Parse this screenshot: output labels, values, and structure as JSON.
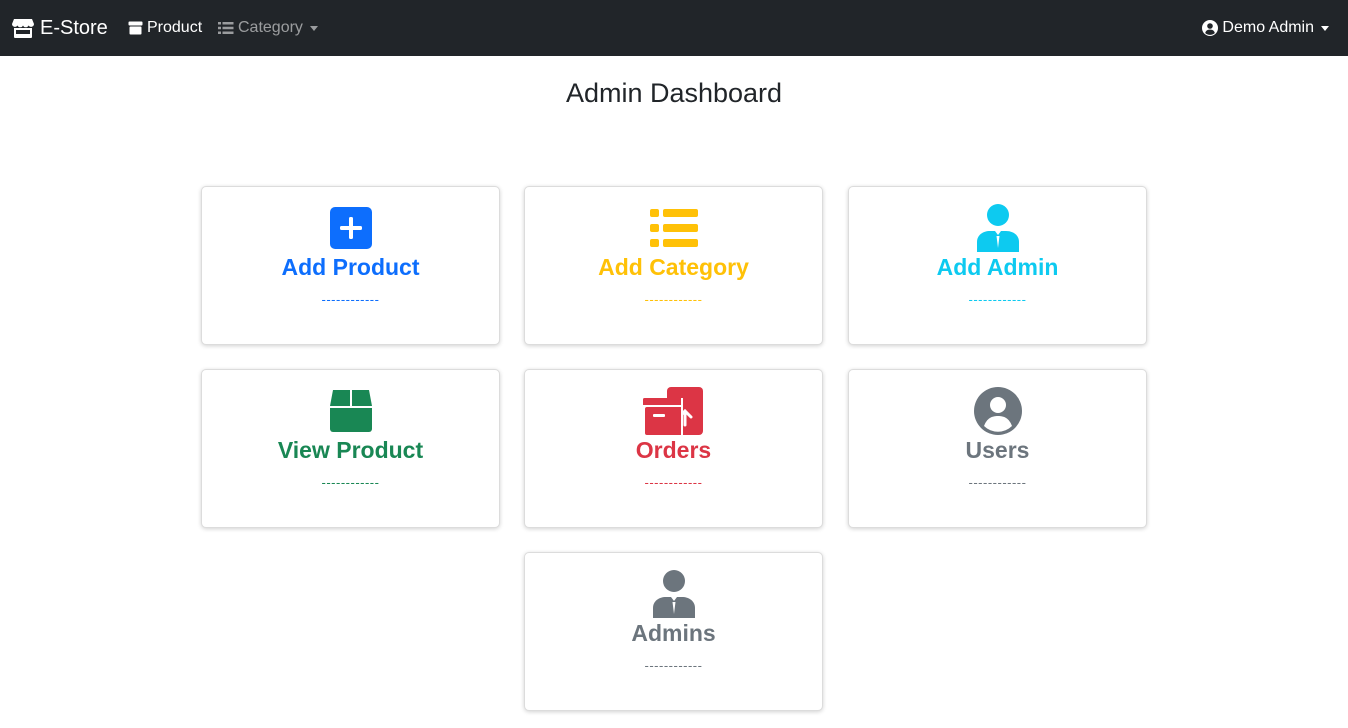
{
  "navbar": {
    "brand": "E-Store",
    "product_label": "Product",
    "category_label": "Category",
    "user_label": "Demo Admin"
  },
  "page": {
    "title": "Admin Dashboard"
  },
  "cards": [
    {
      "label": "Add Product",
      "dash": "------------",
      "color": "#0d6efd",
      "icon": "plus-square-icon"
    },
    {
      "label": "Add Category",
      "dash": "------------",
      "color": "#ffc107",
      "icon": "list-icon"
    },
    {
      "label": "Add Admin",
      "dash": "------------",
      "color": "#0dcaf0",
      "icon": "user-tie-icon"
    },
    {
      "label": "View Product",
      "dash": "------------",
      "color": "#198754",
      "icon": "box-icon"
    },
    {
      "label": "Orders",
      "dash": "------------",
      "color": "#dc3545",
      "icon": "boxes-icon"
    },
    {
      "label": "Users",
      "dash": "------------",
      "color": "#6c757d",
      "icon": "user-circle-icon"
    },
    {
      "label": "Admins",
      "dash": "------------",
      "color": "#6c757d",
      "icon": "user-tie-icon"
    }
  ]
}
